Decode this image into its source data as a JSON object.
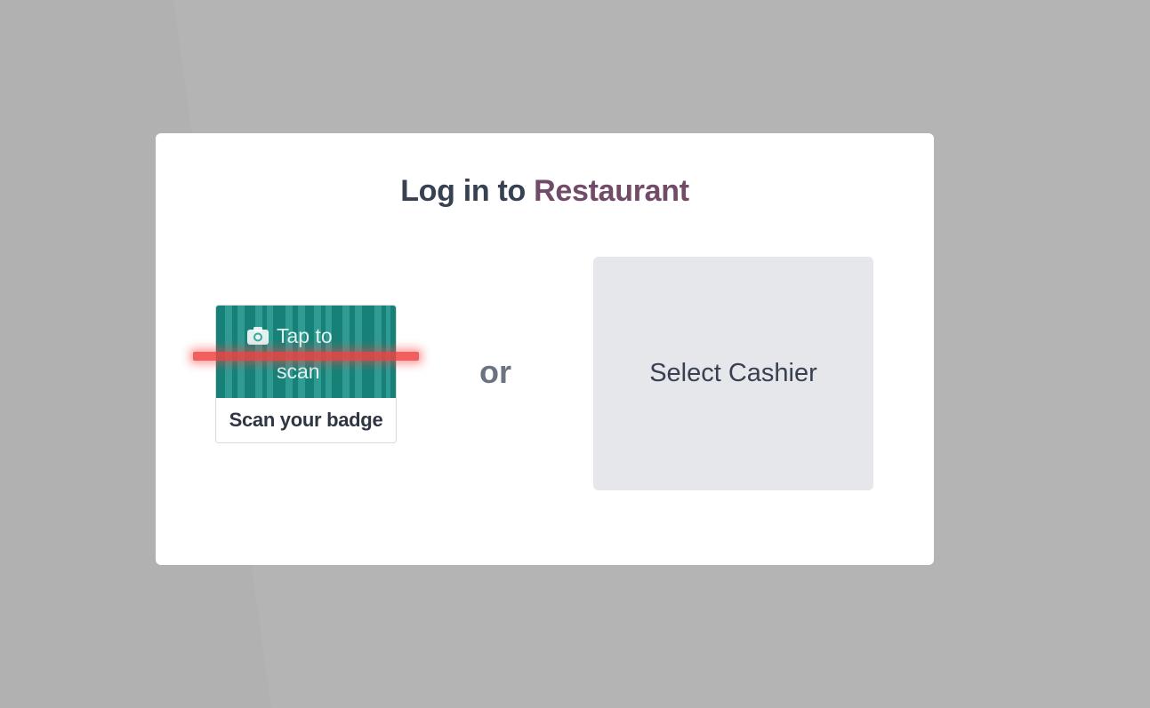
{
  "login": {
    "title_prefix": "Log in to",
    "title_brand": "Restaurant",
    "scan": {
      "overlay_text": "Tap to scan",
      "label": "Scan your badge",
      "icon": "camera-icon"
    },
    "separator": "or",
    "select_cashier_label": "Select Cashier"
  },
  "colors": {
    "brand": "#714B67",
    "backdrop": "#b1b1b1",
    "scan_teal": "#24978d",
    "laser_red": "#ef4444",
    "cashier_bg": "#e6e7eb"
  }
}
